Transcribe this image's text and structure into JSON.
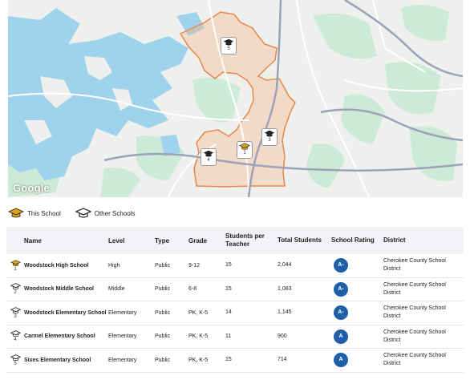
{
  "map": {
    "attribution": "Google",
    "markers": [
      {
        "label": "5",
        "kind": "other"
      },
      {
        "label": "3",
        "kind": "other"
      },
      {
        "label": "1",
        "kind": "this"
      },
      {
        "label": "4",
        "kind": "other"
      }
    ]
  },
  "legend": {
    "this_school": "This School",
    "other_schools": "Other Schools"
  },
  "table": {
    "headers": {
      "name": "Name",
      "level": "Level",
      "type": "Type",
      "grade": "Grade",
      "students_per_teacher": "Students per Teacher",
      "total_students": "Total Students",
      "school_rating": "School Rating",
      "district": "District"
    },
    "rows": [
      {
        "num": "1",
        "name": "Woodstock High School",
        "level": "High",
        "type": "Public",
        "grade": "9-12",
        "spt": "15",
        "total": "2,044",
        "rating": "A-",
        "district": "Cherokee County School District",
        "this_school": true
      },
      {
        "num": "2",
        "name": "Woodstock Middle School",
        "level": "Middle",
        "type": "Public",
        "grade": "6-8",
        "spt": "15",
        "total": "1,083",
        "rating": "A-",
        "district": "Cherokee County School District",
        "this_school": false
      },
      {
        "num": "3",
        "name": "Woodstock Elementary School",
        "level": "Elementary",
        "type": "Public",
        "grade": "PK, K-5",
        "spt": "14",
        "total": "1,145",
        "rating": "A-",
        "district": "Cherokee County School District",
        "this_school": false
      },
      {
        "num": "4",
        "name": "Carmel Elementary School",
        "level": "Elementary",
        "type": "Public",
        "grade": "PK, K-5",
        "spt": "11",
        "total": "900",
        "rating": "A",
        "district": "Cherokee County School District",
        "this_school": false
      },
      {
        "num": "5",
        "name": "Sixes Elementary School",
        "level": "Elementary",
        "type": "Public",
        "grade": "PK, K-5",
        "spt": "15",
        "total": "714",
        "rating": "A",
        "district": "Cherokee County School District",
        "this_school": false
      }
    ]
  },
  "colors": {
    "this_school_icon": "#d9a521",
    "other_school_icon": "#1f1f1f",
    "rating_badge": "#1e5fa8",
    "boundary": "#e8874a",
    "water": "#9fd3ec",
    "park": "#c9ead5"
  }
}
